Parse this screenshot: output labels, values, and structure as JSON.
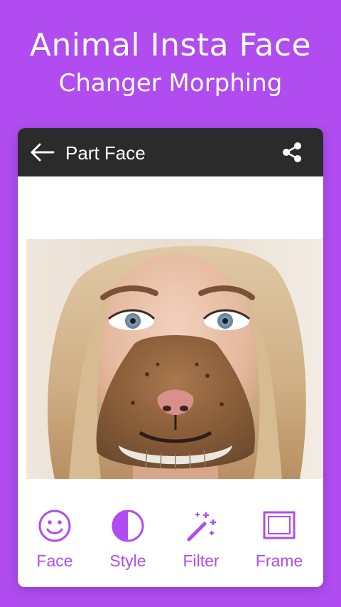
{
  "promo": {
    "title": "Animal Insta Face",
    "subtitle": "Changer Morphing"
  },
  "app_bar": {
    "title": "Part Face",
    "back_icon": "arrow-left-icon",
    "share_icon": "share-icon"
  },
  "toolbar": {
    "items": [
      {
        "label": "Face",
        "icon": "smiley-icon"
      },
      {
        "label": "Style",
        "icon": "contrast-icon"
      },
      {
        "label": "Filter",
        "icon": "magic-wand-icon"
      },
      {
        "label": "Frame",
        "icon": "frame-icon"
      }
    ]
  },
  "colors": {
    "background": "#b04cf0",
    "accent": "#b04cf0",
    "app_bar": "#2b2b2b"
  }
}
